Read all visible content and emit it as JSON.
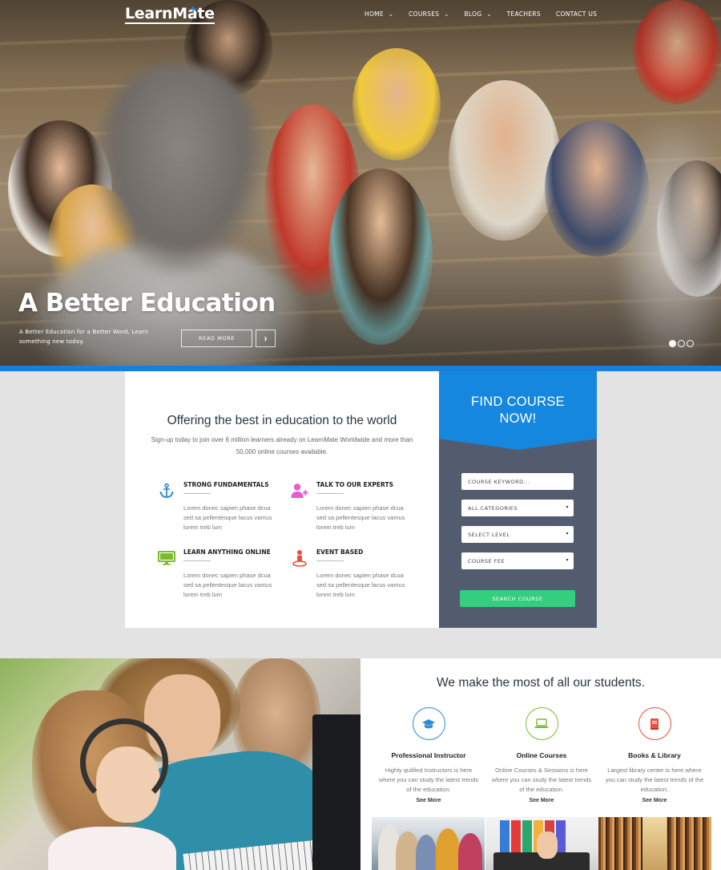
{
  "brand": {
    "name": "LearnMate",
    "plus": "+"
  },
  "nav": {
    "items": [
      {
        "label": "HOME",
        "caret": "⌄"
      },
      {
        "label": "COURSES",
        "caret": "⌄"
      },
      {
        "label": "BLOG",
        "caret": "⌄"
      },
      {
        "label": "TEACHERS",
        "caret": ""
      },
      {
        "label": "CONTACT US",
        "caret": ""
      }
    ]
  },
  "hero": {
    "title": "A Better Education",
    "subtitle": "A Better Education for a Better Word, Learn something new today.",
    "read_more": "READ MORE",
    "next_glyph": "›",
    "slide_count": 3,
    "active_slide": 1
  },
  "intro": {
    "title": "Offering the best in education to the world",
    "description": "Sign-up today to join over 6 million learners already on LearnMate Worldwide and more than 50,000 online courses available."
  },
  "features": [
    {
      "title": "STRONG FUNDAMENTALS",
      "text": "Lorem donec sapien phase dcua sed sa pellentesque lacus vamus lorem treb lum",
      "icon": "anchor-icon",
      "color": "#2a8ad4"
    },
    {
      "title": "TALK TO OUR EXPERTS",
      "text": "Lorem donec sapien phase dcua sed sa pellentesque lacus vamus lorem treb lum",
      "icon": "add-user-icon",
      "color": "#e75bd2"
    },
    {
      "title": "LEARN ANYTHING ONLINE",
      "text": "Lorem donec sapien phase dcua sed sa pellentesque lacus vamus lorem treb lum",
      "icon": "monitor-icon",
      "color": "#7cbb2e"
    },
    {
      "title": "EVENT BASED",
      "text": "Lorem donec sapien phase dcua sed sa pellentesque lacus vamus lorem treb lum",
      "icon": "map-pin-person-icon",
      "color": "#e8503a"
    }
  ],
  "find_course": {
    "title_line1": "FIND COURSE",
    "title_line2": "NOW!",
    "keyword_placeholder": "COURSE KEYWORD...",
    "category": "ALL CATEGORIES",
    "level": "SELECT LEVEL",
    "fee": "COURSE FEE",
    "arrow": "▾",
    "search_label": "SEARCH COURSE",
    "colors": {
      "header": "#1587df",
      "panel": "#525c6e",
      "button": "#33cf7e"
    }
  },
  "students": {
    "title": "We make the most of all our students.",
    "services": [
      {
        "title": "Professional Instructor",
        "text": "Highly qulified Instructors is here where you can study the latest trends of the education.",
        "more": "See More",
        "icon": "graduation-cap-icon",
        "color": "#2a8ad4"
      },
      {
        "title": "Online Courses",
        "text": "Online Courses & Sessions is here where you can study the latest trends of the education.",
        "more": "See More",
        "icon": "laptop-icon",
        "color": "#7cbb2e"
      },
      {
        "title": "Books & Library",
        "text": "Largest library center is here where you can study the latest trends of the education.",
        "more": "See More",
        "icon": "book-icon",
        "color": "#e8503a"
      }
    ]
  }
}
